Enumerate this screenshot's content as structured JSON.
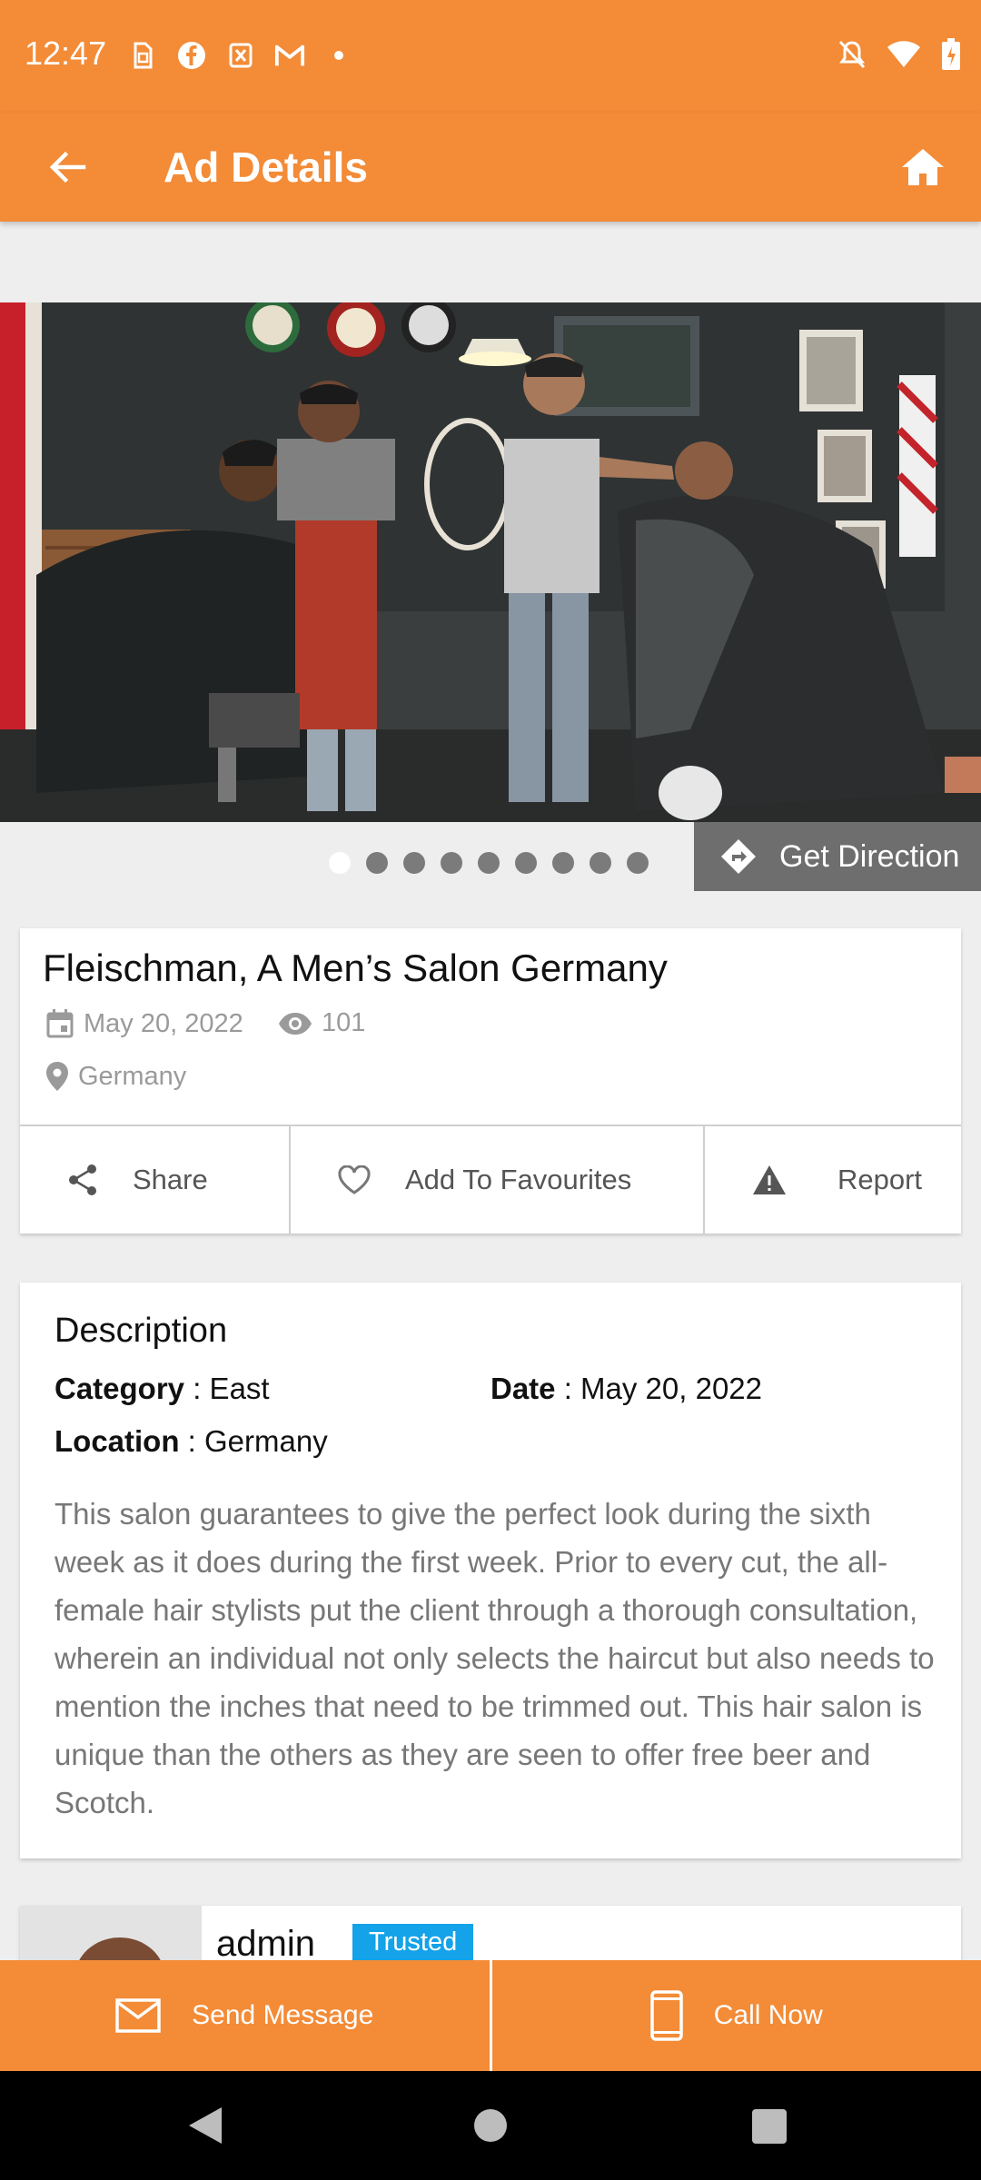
{
  "status_bar": {
    "time": "12:47"
  },
  "app_bar": {
    "title": "Ad Details"
  },
  "gallery": {
    "image_count": 9,
    "active_index": 0,
    "direction_label": "Get Direction"
  },
  "ad": {
    "title": "Fleischman, A Men’s Salon Germany",
    "date": "May 20, 2022",
    "views": "101",
    "location": "Germany"
  },
  "actions": {
    "share": "Share",
    "favourite": "Add To Favourites",
    "report": "Report"
  },
  "description": {
    "heading": "Description",
    "category_label": "Category",
    "category_value": " : East",
    "date_label": "Date",
    "date_value": " : May 20, 2022",
    "location_label": "Location",
    "location_value": " : Germany",
    "body": "This salon guarantees to give the perfect look during the sixth week as it does during the first week. Prior to every cut, the all-female hair stylists put the client through a thorough consultation, wherein an individual not only selects the haircut but also needs to mention the inches that need to be trimmed out. This hair salon is unique than the others as they are seen to offer free beer and Scotch."
  },
  "seller": {
    "name": "admin",
    "badge": "Trusted"
  },
  "bottom_bar": {
    "message": "Send Message",
    "call": "Call Now"
  },
  "colors": {
    "primary": "#f38b37",
    "badge": "#14a2e8",
    "text_muted": "#9a9a9a"
  }
}
